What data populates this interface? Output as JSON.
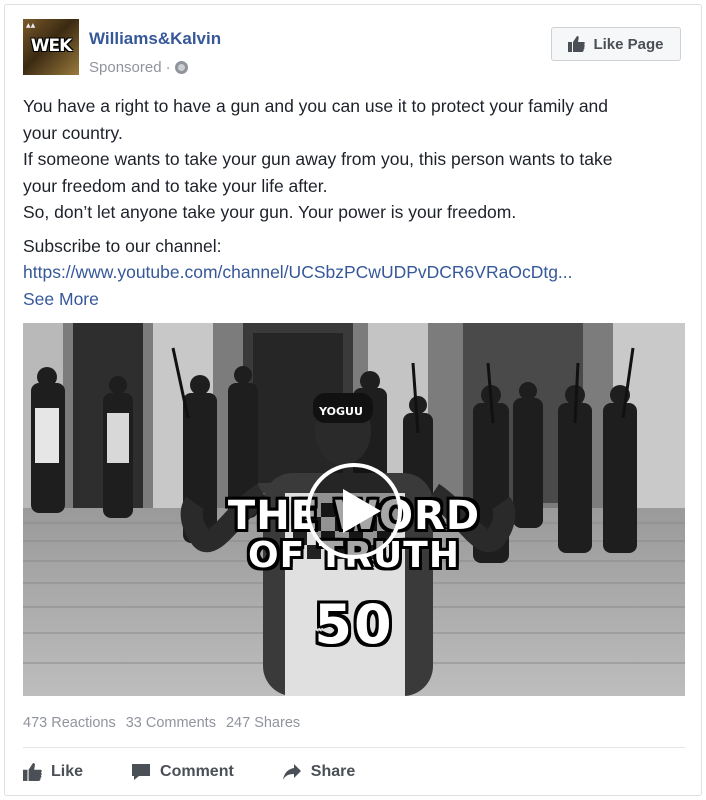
{
  "post": {
    "page_name": "Williams&Kalvin",
    "sponsored_label": "Sponsored",
    "separator": "·",
    "like_page_label": "Like Page",
    "logo_text": "WEK",
    "text_lines": [
      "You have a right to have a gun and you can use it to protect your family and",
      "your country.",
      "If someone wants to take your gun away from you, this person wants to take",
      "your freedom and to take your life after.",
      "So, don’t let anyone take your gun. Your power is your freedom."
    ],
    "subscribe_label": "Subscribe to our channel:",
    "link_text": "https://www.youtube.com/channel/UCSbzPCwUDPvDCR6VRaOcDtg...",
    "see_more_label": "See More"
  },
  "video": {
    "overlay_line1": "THE WORD",
    "overlay_line2": "OF TRUTH",
    "overlay_number": "50",
    "beanie_text": "YOGUU"
  },
  "stats": {
    "reactions": "473 Reactions",
    "comments": "33 Comments",
    "shares": "247 Shares"
  },
  "actions": {
    "like_label": "Like",
    "comment_label": "Comment",
    "share_label": "Share"
  },
  "colors": {
    "link_blue": "#365899",
    "meta_gray": "#90949c",
    "button_text": "#4b4f56"
  }
}
